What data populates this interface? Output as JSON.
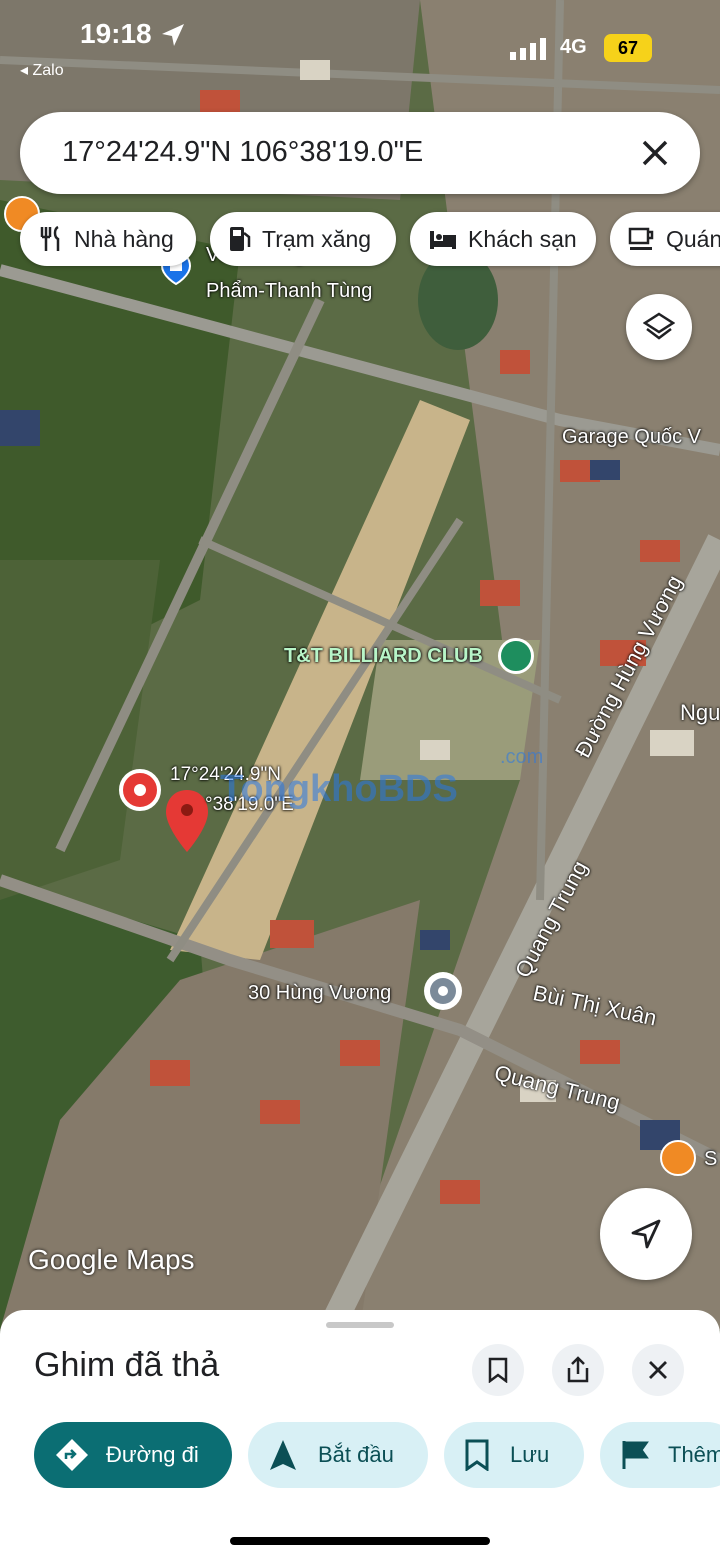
{
  "status_bar": {
    "time": "19:18",
    "back_app": "◂ Zalo",
    "network": "4G",
    "battery": "67"
  },
  "search": {
    "query": "17°24'24.9\"N 106°38'19.0\"E"
  },
  "chips": [
    "Nhà hàng",
    "Trạm xăng",
    "Khách sạn",
    "Quán"
  ],
  "map_labels": {
    "shop_top": "Văn Phòng",
    "shop": "Phẩm-Thanh Tùng",
    "garage": "Garage Quốc V",
    "billiard": "T&T BILLIARD CLUB",
    "road_hung_vuong": "Đường Hùng Vương",
    "ngu": "Ngu",
    "pin_coord_1": "17°24'24.9\"N",
    "pin_coord_2": "°38'19.0\"E",
    "watermark": "TongkhoBDS",
    "watermark_suffix": ".com",
    "address_30": "30 Hùng Vương",
    "quang_trung_1": "Quang Trung",
    "bui_thi_xuan": "Bùi Thị Xuân",
    "quang_trung_2": "Quang Trung",
    "s_label": "S",
    "google_maps": "Google Maps"
  },
  "sheet": {
    "title": "Ghim đã thả",
    "actions": [
      "Đường đi",
      "Bắt đầu",
      "Lưu",
      "Thêm"
    ]
  },
  "colors": {
    "primary": "#0b6e73",
    "chip_bg": "#d8f0f5",
    "pin": "#e53935",
    "poi_green": "#1e8e5e",
    "cafe": "#f08a24"
  }
}
